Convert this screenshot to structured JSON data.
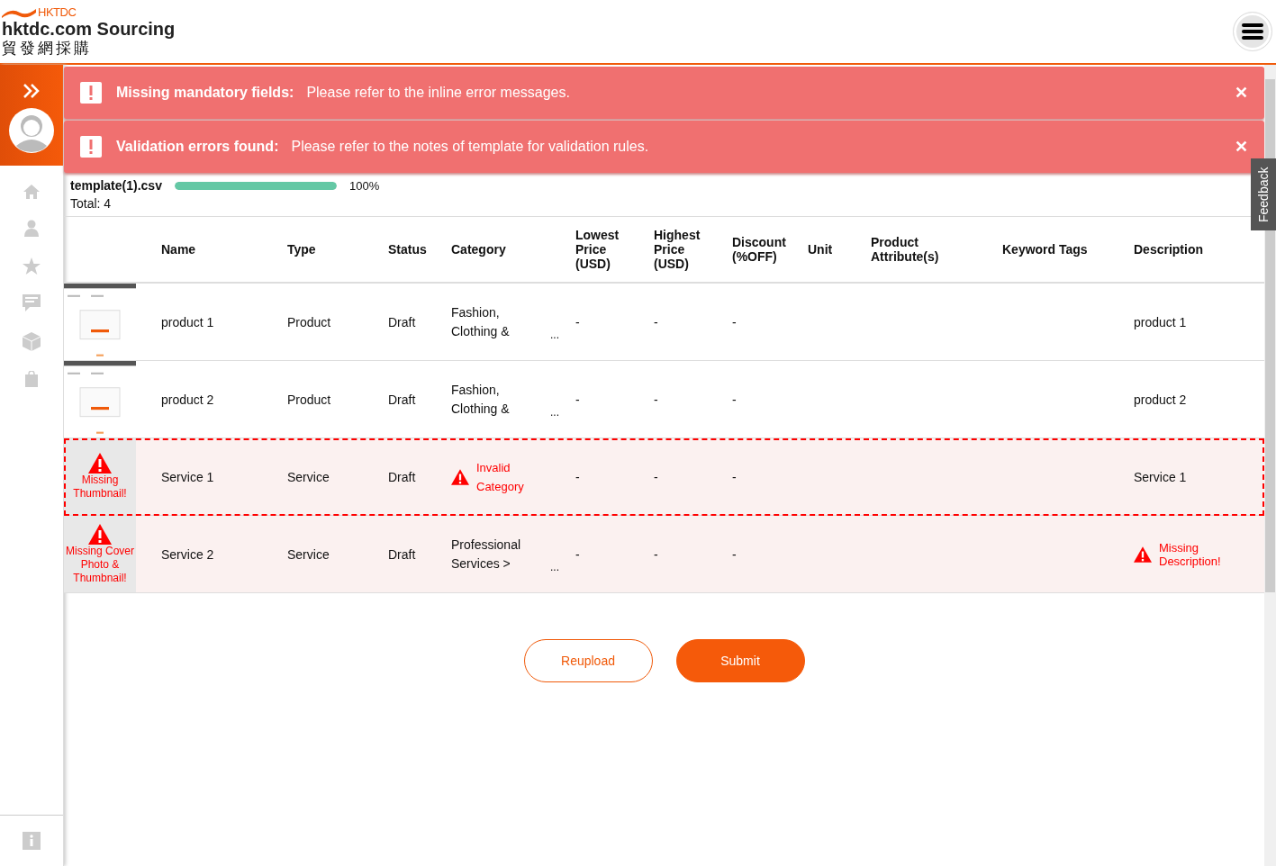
{
  "header": {
    "logo_mark": "HKTDC",
    "site_name": "hktdc.com Sourcing",
    "site_name_chinese": "貿發網採購"
  },
  "alerts": [
    {
      "title": "Missing mandatory fields:",
      "message": "Please refer to the inline error messages.",
      "close": "✕"
    },
    {
      "title": "Validation errors found:",
      "message": "Please refer to the notes of template for validation rules.",
      "close": "✕"
    }
  ],
  "upload": {
    "file_name": "template(1).csv",
    "level": 1,
    "percent": "100%",
    "total": "Total: 4"
  },
  "table": {
    "columns": [
      "Name",
      "Type",
      "Status",
      "Category",
      "Lowest Price (USD)",
      "Highest Price (USD)",
      "Discount (%OFF)",
      "Unit",
      "Product Attribute(s)",
      "Keyword Tags",
      "Description"
    ],
    "rows": [
      {
        "name": "product 1",
        "type": "Product",
        "status": "Draft",
        "category": {
          "kind": "text",
          "text": "Fashion, Clothing &",
          "more": "..."
        },
        "lowest_price": "-",
        "highest_price": "-",
        "discount": "-",
        "description": {
          "kind": "text",
          "text": "product 1"
        },
        "has_errors": false,
        "selected": false
      },
      {
        "name": "product 2",
        "type": "Product",
        "status": "Draft",
        "category": {
          "kind": "text",
          "text": "Fashion, Clothing &",
          "more": "..."
        },
        "lowest_price": "-",
        "highest_price": "-",
        "discount": "-",
        "description": {
          "kind": "text",
          "text": "product 2"
        },
        "has_errors": false,
        "selected": false
      },
      {
        "thumbnail": {
          "kind": "error",
          "text": "Missing Thumbnail!"
        },
        "name": "Service 1",
        "type": "Service",
        "status": "Draft",
        "category": {
          "kind": "error",
          "text": "Invalid Category"
        },
        "lowest_price": "-",
        "highest_price": "-",
        "discount": "-",
        "description": {
          "kind": "text",
          "text": "Service 1"
        },
        "has_errors": true,
        "selected": true
      },
      {
        "thumbnail": {
          "kind": "error",
          "text": "Missing Cover Photo & Thumbnail!"
        },
        "name": "Service 2",
        "type": "Service",
        "status": "Draft",
        "category": {
          "kind": "text",
          "text": "Professional Services >",
          "more": "..."
        },
        "lowest_price": "-",
        "highest_price": "-",
        "discount": "-",
        "description": {
          "kind": "error",
          "text": "Missing Description!"
        },
        "has_errors": true,
        "selected": false
      }
    ]
  },
  "buttons": [
    {
      "kind": "secondary",
      "label": "Reupload"
    },
    {
      "kind": "primary",
      "label": "Submit"
    }
  ],
  "feedback_tab": "Feedback"
}
